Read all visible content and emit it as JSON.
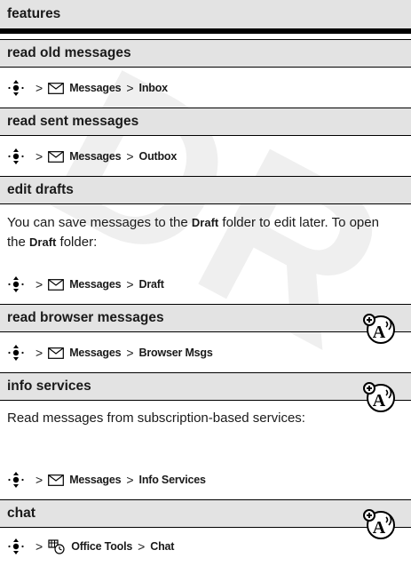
{
  "watermark": "DR",
  "header": {
    "title": "features"
  },
  "sections": [
    {
      "title": "read old messages",
      "path": {
        "menu": "Messages",
        "item": "Inbox"
      }
    },
    {
      "title": "read sent messages",
      "path": {
        "menu": "Messages",
        "item": "Outbox"
      }
    },
    {
      "title": "edit drafts",
      "text_before": "You can save messages to the ",
      "strong1": "Draft",
      "text_mid": " folder to edit later. To open the ",
      "strong2": "Draft",
      "text_after": " folder:",
      "path": {
        "menu": "Messages",
        "item": "Draft"
      }
    },
    {
      "title": "read browser messages",
      "path": {
        "menu": "Messages",
        "item": "Browser Msgs"
      },
      "icon": "network-feature-icon"
    },
    {
      "title": "info services",
      "text": "Read messages from subscription-based services:",
      "path": {
        "menu": "Messages",
        "item": "Info Services"
      },
      "icon": "network-feature-icon"
    },
    {
      "title": "chat",
      "path": {
        "menu": "Office Tools",
        "item": "Chat"
      },
      "icon": "network-feature-icon"
    }
  ],
  "separator": ">"
}
